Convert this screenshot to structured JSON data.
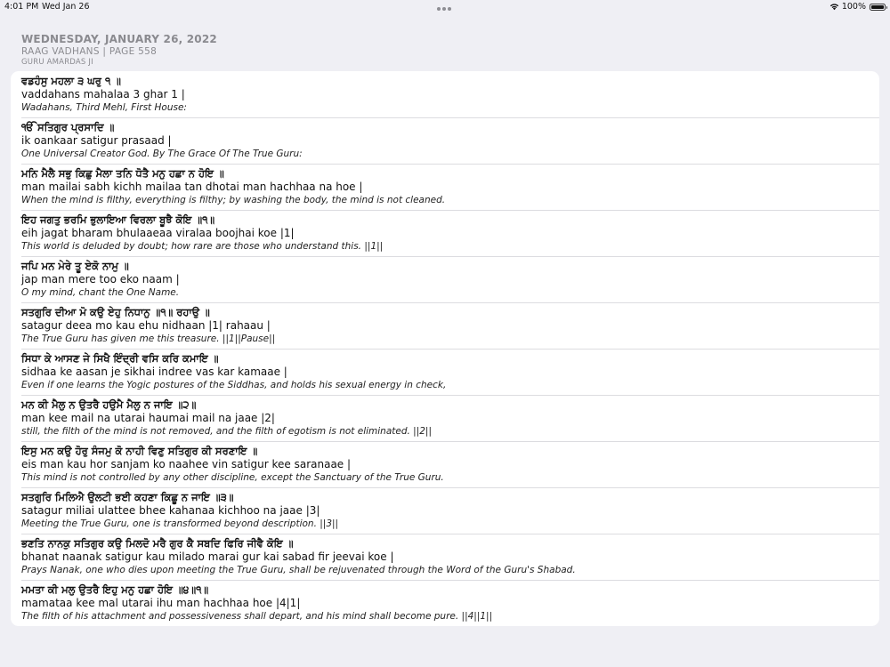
{
  "status_bar": {
    "time": "4:01 PM",
    "date": "Wed Jan 26",
    "battery": "100%"
  },
  "header": {
    "date": "WEDNESDAY, JANUARY 26, 2022",
    "raag_page": "RAAG VADHANS | PAGE 558",
    "author": "GURU AMARDAS JI"
  },
  "verses": [
    {
      "gurmukhi": "ਵਡਹੰਸੁ ਮਹਲਾ ੩ ਘਰੁ ੧ ॥",
      "transliteration": "vaddahans mahalaa 3 ghar 1 |",
      "translation": "Wadahans, Third Mehl, First House:"
    },
    {
      "gurmukhi": "ੴ ਸਤਿਗੁਰ ਪ੍ਰਸਾਦਿ ॥",
      "transliteration": "ik oankaar satigur prasaad |",
      "translation": "One Universal Creator God. By The Grace Of The True Guru:"
    },
    {
      "gurmukhi": "ਮਨਿ ਮੈਲੈ ਸਭੁ ਕਿਛੁ ਮੈਲਾ ਤਨਿ ਧੋਤੈ ਮਨੁ ਹਛਾ ਨ ਹੋਇ ॥",
      "transliteration": "man mailai sabh kichh mailaa tan dhotai man hachhaa na hoe |",
      "translation": "When the mind is filthy, everything is filthy; by washing the body, the mind is not cleaned."
    },
    {
      "gurmukhi": "ਇਹ ਜਗਤੁ ਭਰਮਿ ਭੁਲਾਇਆ ਵਿਰਲਾ ਬੂਝੈ ਕੋਇ ॥੧॥",
      "transliteration": "eih jagat bharam bhulaaeaa viralaa boojhai koe |1|",
      "translation": "This world is deluded by doubt; how rare are those who understand this. ||1||"
    },
    {
      "gurmukhi": "ਜਪਿ ਮਨ ਮੇਰੇ ਤੂ ਏਕੋ ਨਾਮੁ ॥",
      "transliteration": "jap man mere too eko naam |",
      "translation": "O my mind, chant the One Name."
    },
    {
      "gurmukhi": "ਸਤਗੁਰਿ ਦੀਆ ਮੋ ਕਉ ਏਹੁ ਨਿਧਾਨੁ ॥੧॥ ਰਹਾਉ ॥",
      "transliteration": "satagur deea mo kau ehu nidhaan |1| rahaau |",
      "translation": "The True Guru has given me this treasure. ||1||Pause||"
    },
    {
      "gurmukhi": "ਸਿਧਾ ਕੇ ਆਸਣ ਜੇ ਸਿਖੈ ਇੰਦ੍ਰੀ ਵਸਿ ਕਰਿ ਕਮਾਇ ॥",
      "transliteration": "sidhaa ke aasan je sikhai indree vas kar kamaae |",
      "translation": "Even if one learns the Yogic postures of the Siddhas, and holds his sexual energy in check,"
    },
    {
      "gurmukhi": "ਮਨ ਕੀ ਮੈਲੁ ਨ ਉਤਰੈ ਹਉਮੈ ਮੈਲੁ ਨ ਜਾਇ ॥੨॥",
      "transliteration": "man kee mail na utarai haumai mail na jaae |2|",
      "translation": "still, the filth of the mind is not removed, and the filth of egotism is not eliminated. ||2||"
    },
    {
      "gurmukhi": "ਇਸੁ ਮਨ ਕਉ ਹੋਰੁ ਸੰਜਮੁ ਕੋ ਨਾਹੀ ਵਿਣੁ ਸਤਿਗੁਰ ਕੀ ਸਰਣਾਇ ॥",
      "transliteration": "eis man kau hor sanjam ko naahee vin satigur kee saranaae |",
      "translation": "This mind is not controlled by any other discipline, except the Sanctuary of the True Guru."
    },
    {
      "gurmukhi": "ਸਤਗੁਰਿ ਮਿਲਿਐ ਉਲਟੀ ਭਈ ਕਹਣਾ ਕਿਛੂ ਨ ਜਾਇ ॥੩॥",
      "transliteration": "satagur miliai ulattee bhee kahanaa kichhoo na jaae |3|",
      "translation": "Meeting the True Guru, one is transformed beyond description. ||3||"
    },
    {
      "gurmukhi": "ਭਣਤਿ ਨਾਨਕੁ ਸਤਿਗੁਰ ਕਉ ਮਿਲਦੋ ਮਰੈ ਗੁਰ ਕੈ ਸਬਦਿ ਫਿਰਿ ਜੀਵੈ ਕੋਇ ॥",
      "transliteration": "bhanat naanak satigur kau milado marai gur kai sabad fir jeevai koe |",
      "translation": "Prays Nanak, one who dies upon meeting the True Guru, shall be rejuvenated through the Word of the Guru's Shabad."
    },
    {
      "gurmukhi": "ਮਮਤਾ ਕੀ ਮਲੁ ਉਤਰੈ ਇਹੁ ਮਨੁ ਹਛਾ ਹੋਇ ॥੪॥੧॥",
      "transliteration": "mamataa kee mal utarai ihu man hachhaa hoe |4|1|",
      "translation": "The filth of his attachment and possessiveness shall depart, and his mind shall become pure. ||4||1||"
    }
  ]
}
